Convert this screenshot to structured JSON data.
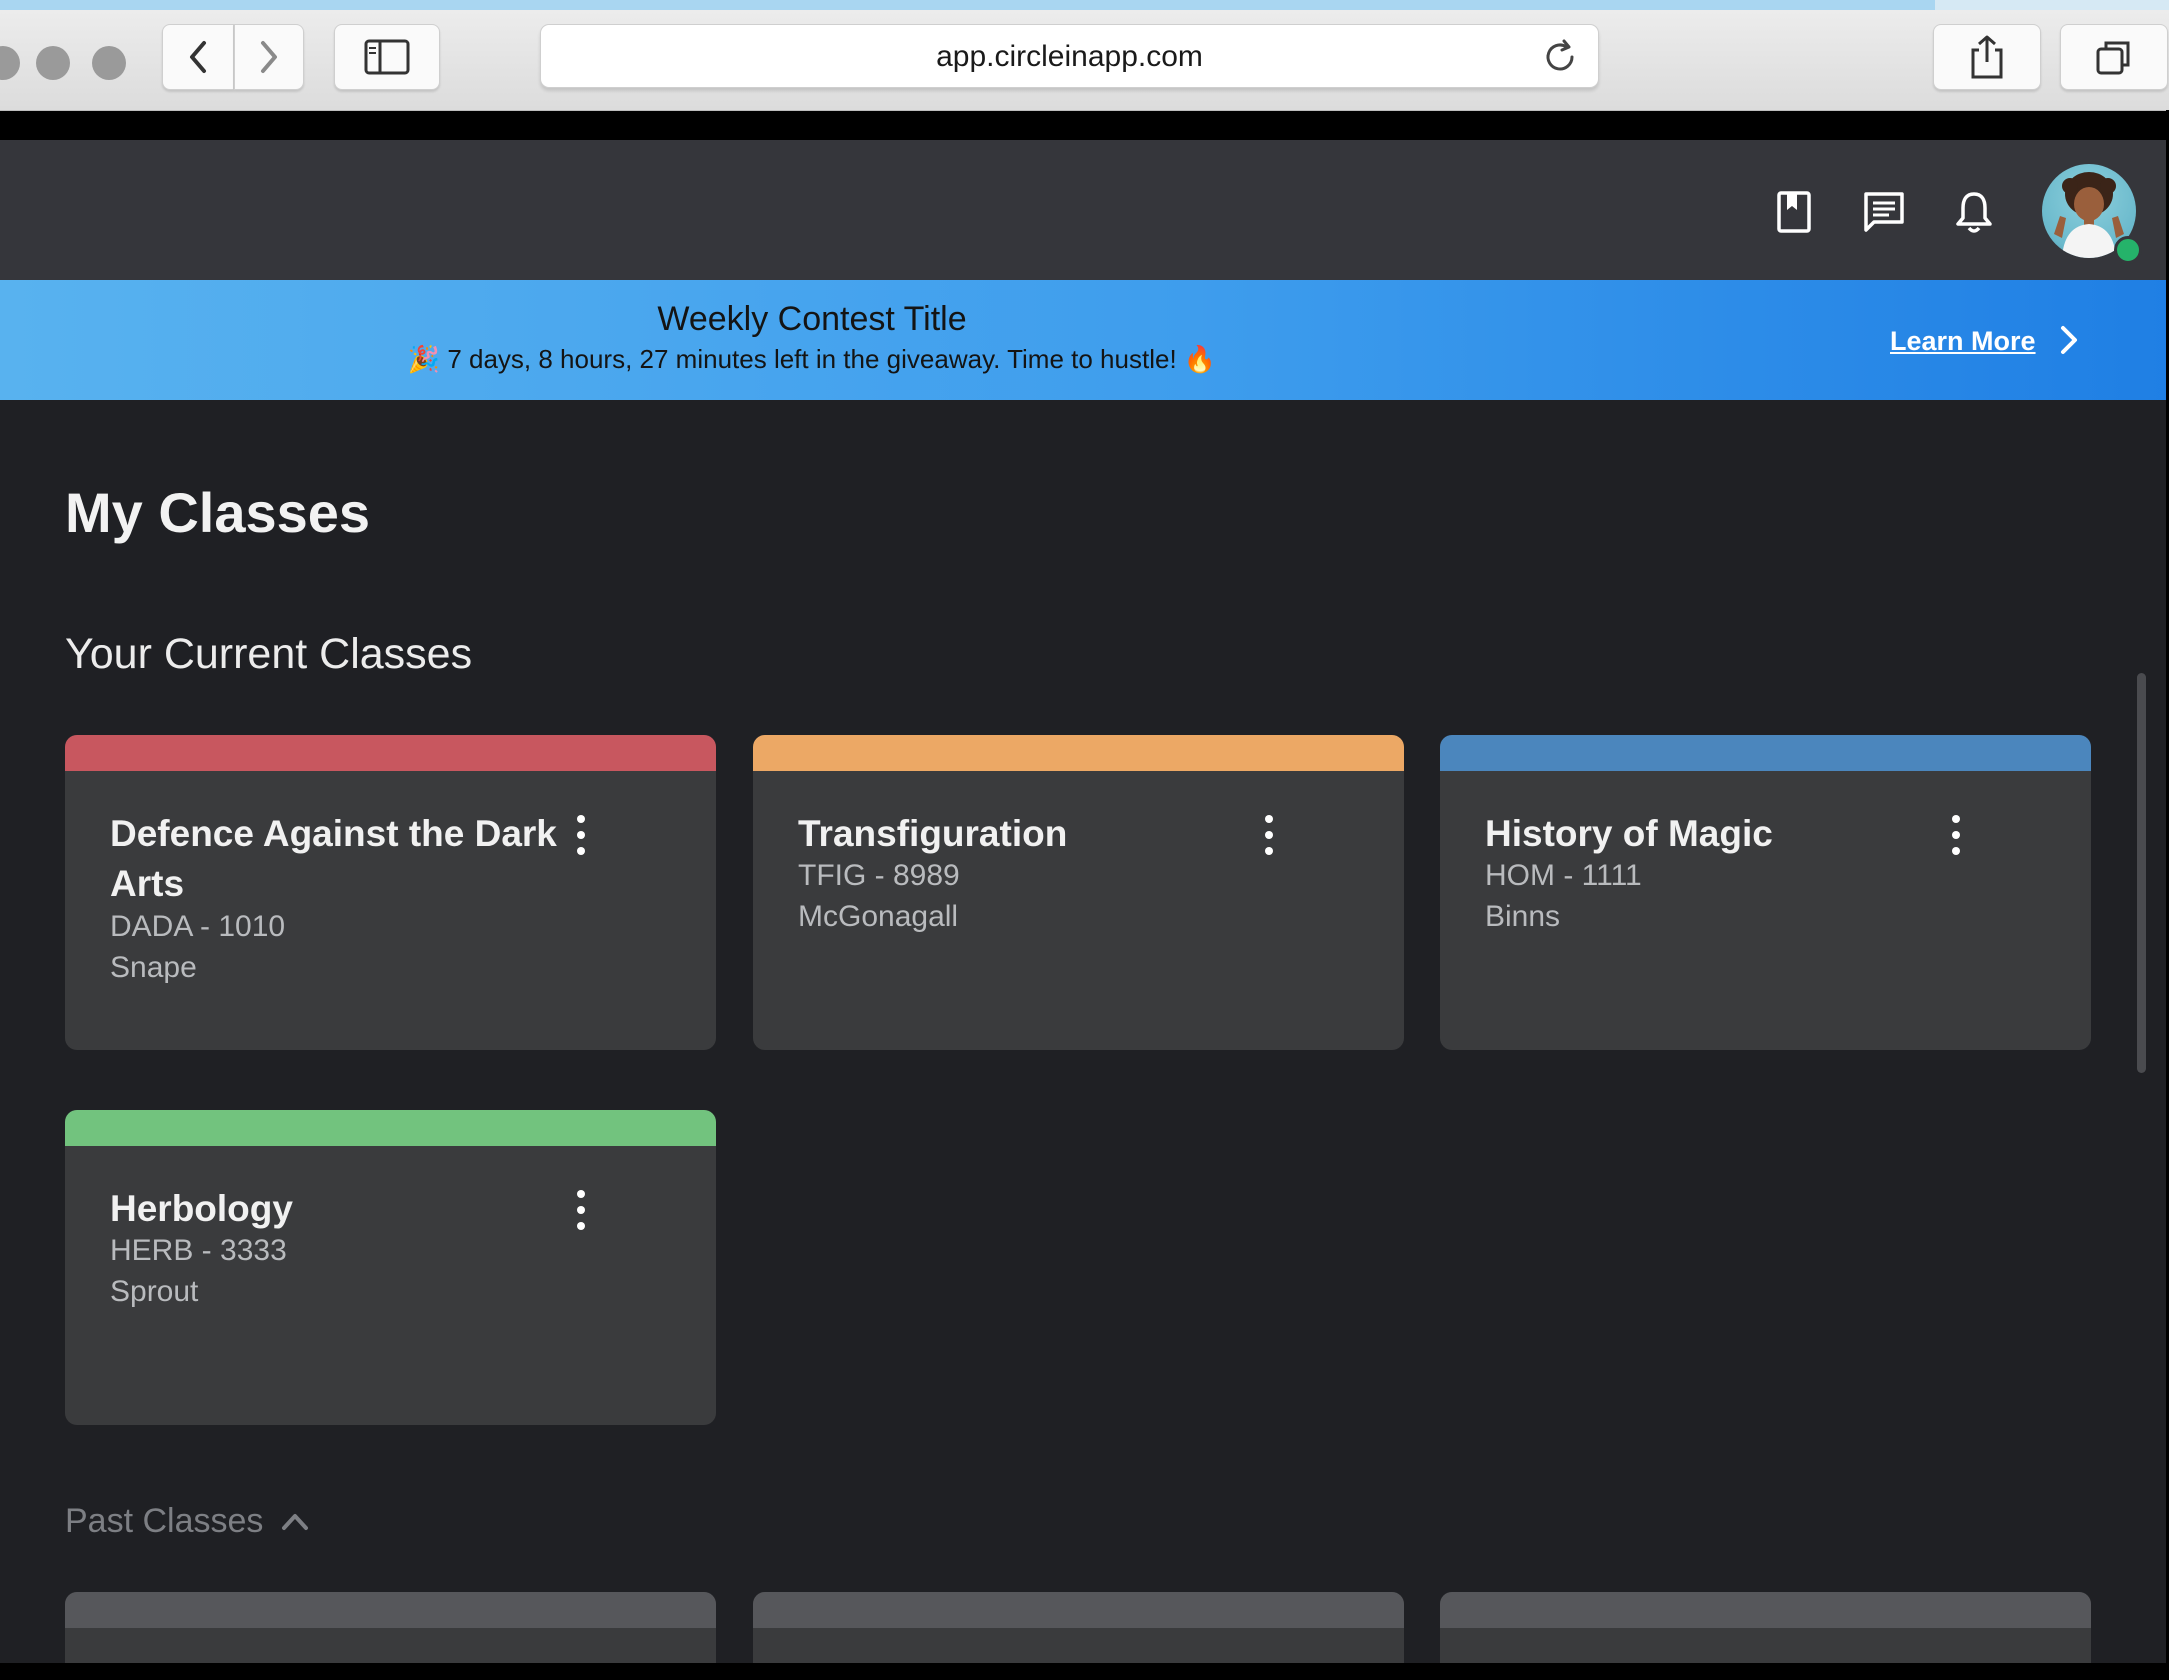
{
  "browser": {
    "url": "app.circleinapp.com"
  },
  "header": {
    "icons": [
      "bookmark-icon",
      "chat-icon",
      "bell-icon"
    ],
    "avatar_online": true
  },
  "banner": {
    "title": "Weekly Contest Title",
    "subtitle": "🎉 7 days, 8 hours, 27 minutes left in the giveaway. Time to hustle! 🔥",
    "link_label": "Learn More"
  },
  "page": {
    "title": "My Classes",
    "current_section": "Your Current Classes",
    "past_section": "Past Classes"
  },
  "classes": [
    {
      "name": "Defence Against the Dark Arts",
      "code": "DADA - 1010",
      "teacher": "Snape",
      "color": "#c8575f"
    },
    {
      "name": "Transfiguration",
      "code": "TFIG - 8989",
      "teacher": "McGonagall",
      "color": "#eca865"
    },
    {
      "name": "History of Magic",
      "code": "HOM - 1111",
      "teacher": "Binns",
      "color": "#4b86bd"
    },
    {
      "name": "Herbology",
      "code": "HERB - 3333",
      "teacher": "Sprout",
      "color": "#72c37e"
    }
  ],
  "colors": {
    "header_bg": "#35363b",
    "page_bg": "#1f2024",
    "card_bg": "#3a3b3d",
    "banner_start": "#58b2ef",
    "banner_end": "#1f7fe4"
  }
}
